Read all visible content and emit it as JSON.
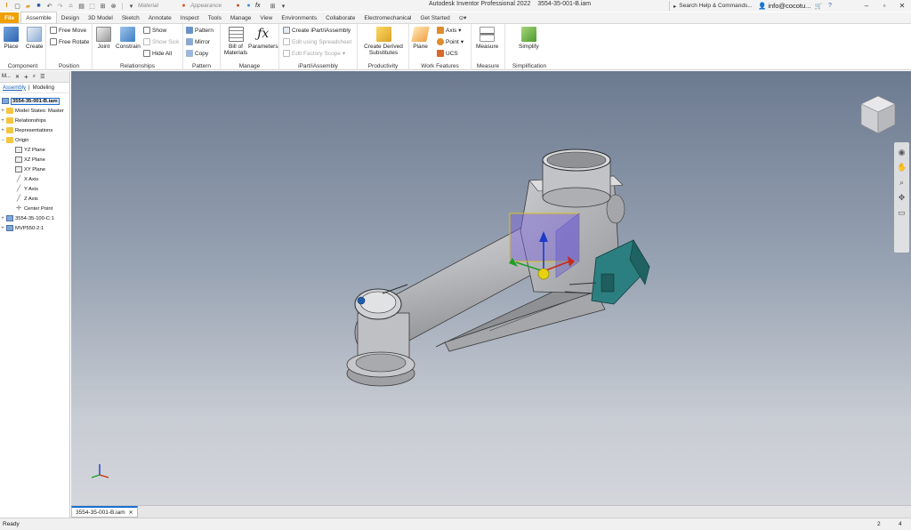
{
  "titlebar": {
    "material_label": "Material",
    "appearance_label": "Appearance",
    "fx_label": "fx",
    "app_title": "Autodesk Inventor Professional 2022",
    "file_name": "3554-35-001-B.iam",
    "search_help": "Search Help & Commands...",
    "user": "info@cocotu..."
  },
  "tabs": [
    "File",
    "Assemble",
    "Design",
    "3D Model",
    "Sketch",
    "Annotate",
    "Inspect",
    "Tools",
    "Manage",
    "View",
    "Environments",
    "Collaborate",
    "Electromechanical",
    "Get Started"
  ],
  "ribbon": {
    "component": {
      "label": "Component",
      "place": "Place",
      "create": "Create"
    },
    "position": {
      "label": "Position",
      "free_move": "Free Move",
      "free_rotate": "Free Rotate"
    },
    "relationships": {
      "label": "Relationships",
      "joint": "Joint",
      "constrain": "Constrain",
      "show": "Show",
      "show_sick": "Show Sick",
      "hide_all": "Hide All"
    },
    "pattern": {
      "label": "Pattern",
      "pattern": "Pattern",
      "mirror": "Mirror",
      "copy": "Copy"
    },
    "manage": {
      "label": "Manage",
      "bom": "Bill of Materials",
      "parameters": "Parameters"
    },
    "ipart": {
      "label": "iPart/iAssembly",
      "create": "Create iPart/iAssembly",
      "edit_spreadsheet": "Edit using Spreadsheet",
      "edit_factory": "Edit Factory Scope"
    },
    "productivity": {
      "label": "Productivity",
      "create_derived": "Create Derived Substitutes"
    },
    "work_features": {
      "label": "Work Features",
      "plane": "Plane",
      "axis": "Axis",
      "point": "Point",
      "ucs": "UCS"
    },
    "measure": {
      "label": "Measure",
      "measure": "Measure"
    },
    "simplification": {
      "label": "Simplification",
      "simplify": "Simplify"
    }
  },
  "browser": {
    "title": "M...",
    "tab_assembly": "Assembly",
    "tab_modeling": "Modeling",
    "nodes": [
      {
        "label": "3554-35-001-B.iam"
      },
      {
        "label": "Model States: Master"
      },
      {
        "label": "Relationships"
      },
      {
        "label": "Representations"
      },
      {
        "label": "Origin"
      },
      {
        "label": "YZ Plane"
      },
      {
        "label": "XZ Plane"
      },
      {
        "label": "XY Plane"
      },
      {
        "label": "X Axis"
      },
      {
        "label": "Y Axis"
      },
      {
        "label": "Z Axis"
      },
      {
        "label": "Center Point"
      },
      {
        "label": "3554-35-100-C:1"
      },
      {
        "label": "MVP550-2:1"
      }
    ]
  },
  "document_tab": "3554-35-001-B.iam",
  "status": {
    "text": "Ready",
    "count1": "2",
    "count2": "4"
  },
  "colors": {
    "file_tab": "#f0a000",
    "accent": "#1b6fd2",
    "viewport_top": "#6c7a90",
    "viewport_bottom": "#d3d6db",
    "motor_teal": "#2c7f80"
  }
}
